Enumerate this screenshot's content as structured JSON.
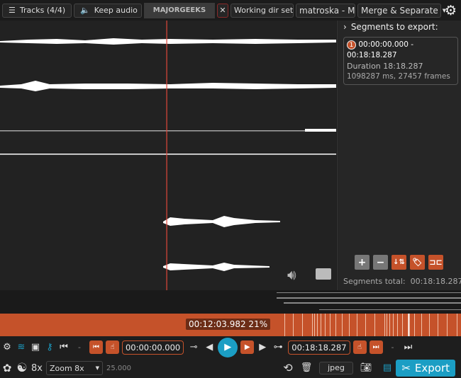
{
  "topbar": {
    "tracks": "Tracks (4/4)",
    "keep_audio": "Keep audio",
    "working_dir": "Working dir set",
    "format": "matroska - M",
    "mode": "Merge & Separate"
  },
  "watermark": "MAJORGEEKS .COM",
  "segments": {
    "header": "Segments to export:",
    "items": [
      {
        "num": "1",
        "range": "00:00:00.000 - 00:18:18.287",
        "duration": "Duration 18:18.287",
        "details": "1098287 ms, 27457 frames"
      }
    ],
    "total_label": "Segments total:",
    "total_value": "00:18:18.287"
  },
  "timeline": {
    "position": "00:12:03.982 21%",
    "progress_percent": 21
  },
  "controls": {
    "start_time": "00:00:00.000",
    "end_time": "00:18:18.287",
    "dash1": "-",
    "dash2": "-",
    "zoom_label": "8x",
    "zoom_select": "Zoom 8x",
    "fps": "25.000",
    "capture_format": "jpeg",
    "export": "Export"
  },
  "colors": {
    "accent": "#c5522a",
    "primary": "#1b9ec4",
    "playhead": "#e0473a"
  }
}
